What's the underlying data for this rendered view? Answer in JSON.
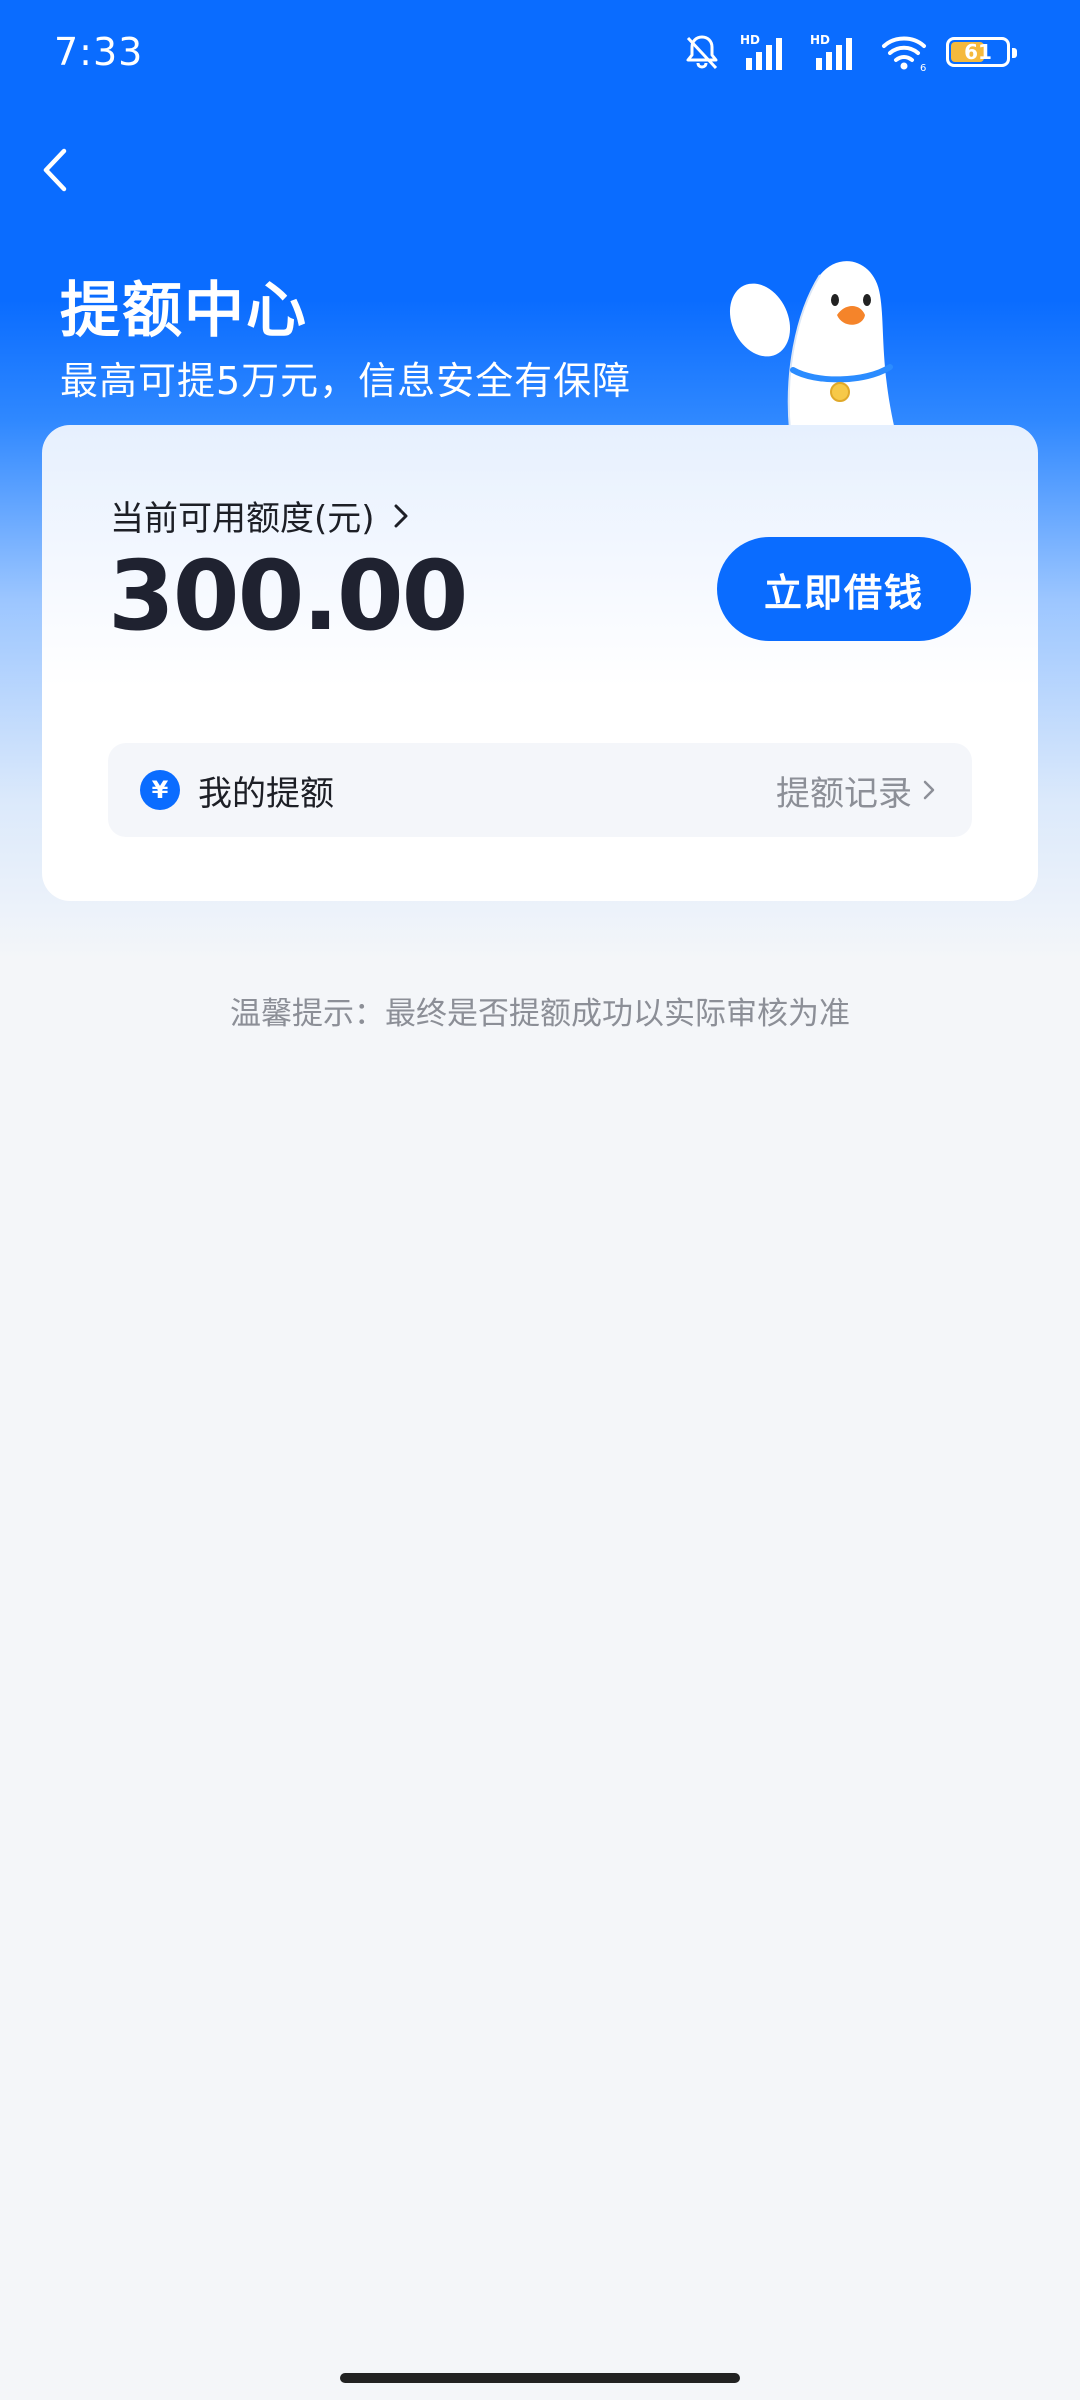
{
  "status_bar": {
    "time": "7:33",
    "battery_level": "61",
    "icons": [
      "bell-muted-icon",
      "signal-hd-icon",
      "signal-hd-icon",
      "wifi-icon",
      "battery-icon"
    ]
  },
  "header": {
    "title": "提额中心",
    "subtitle": "最高可提5万元，信息安全有保障"
  },
  "card": {
    "limit_label": "当前可用额度(元)",
    "limit_amount": "300.00",
    "borrow_button": "立即借钱",
    "my_limit_label": "我的提额",
    "yen_symbol": "¥",
    "record_link": "提额记录"
  },
  "tip": "温馨提示：最终是否提额成功以实际审核为准",
  "colors": {
    "primary": "#0a6cff",
    "background": "#f4f6f9",
    "text_dark": "#1d1f26",
    "text_gray": "#8c8f97",
    "battery": "#f5b93c"
  }
}
